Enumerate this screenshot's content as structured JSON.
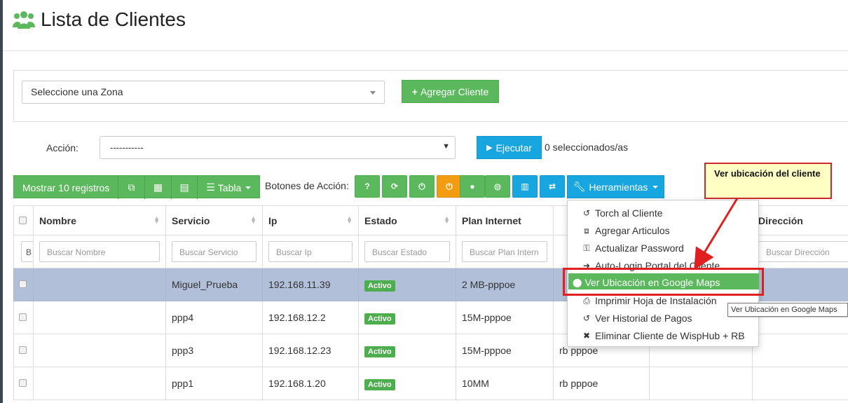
{
  "page": {
    "title": "Lista de Clientes"
  },
  "zone": {
    "placeholder": "Seleccione una Zona",
    "add_client": "Agregar Cliente"
  },
  "action": {
    "label": "Acción:",
    "value": "-----------",
    "execute": "Ejecutar",
    "selected": "0 seleccionados/as"
  },
  "toolbar": {
    "show": "Mostrar 10 registros",
    "tabla": "Tabla",
    "botones_label": "Botones de Acción:",
    "herramientas": "Herramientas"
  },
  "columns": [
    "Nombre",
    "Servicio",
    "Ip",
    "Estado",
    "Plan Internet",
    "",
    "",
    "Dirección"
  ],
  "filters": {
    "first": "B",
    "nombre": "Buscar Nombre",
    "servicio": "Buscar Servicio",
    "ip": "Buscar Ip",
    "estado": "Buscar Estado",
    "plan": "Buscar Plan Intern",
    "direccion": "Buscar Dirección"
  },
  "rows": [
    {
      "nombre": "",
      "servicio": "Miguel_Prueba",
      "ip": "192.168.11.39",
      "estado": "Activo",
      "plan": "2 MB-pppoe",
      "tipo": ""
    },
    {
      "nombre": "",
      "servicio": "ppp4",
      "ip": "192.168.12.2",
      "estado": "Activo",
      "plan": "15M-pppoe",
      "tipo": ""
    },
    {
      "nombre": "",
      "servicio": "ppp3",
      "ip": "192.168.12.23",
      "estado": "Activo",
      "plan": "15M-pppoe",
      "tipo": "rb pppoe"
    },
    {
      "nombre": "",
      "servicio": "ppp1",
      "ip": "192.168.1.20",
      "estado": "Activo",
      "plan": "10MM",
      "tipo": "rb pppoe"
    }
  ],
  "menu": [
    {
      "label": "Torch al Cliente",
      "icon": "history-icon"
    },
    {
      "label": "Agregar Articulos",
      "icon": "cubes-icon"
    },
    {
      "label": "Actualizar Password",
      "icon": "key-icon"
    },
    {
      "label": "Auto-Login Portal del Cliente",
      "icon": "sign-in-icon"
    },
    {
      "label": "Ver Ubicación en Google Maps",
      "icon": "map-marker-icon"
    },
    {
      "label": "Imprimir Hoja de Instalación",
      "icon": "print-icon"
    },
    {
      "label": "Ver Historial de Pagos",
      "icon": "history-icon"
    },
    {
      "label": "Eliminar Cliente de WispHub + RB",
      "icon": "user-times-icon"
    }
  ],
  "callout": {
    "text": "Ver ubicación del cliente"
  },
  "tooltip": {
    "text": "Ver Ubicación en Google Maps"
  },
  "colors": {
    "green": "#5cb85c",
    "blue": "#18a6e0",
    "orange": "#f39c12",
    "selected_row": "#b1bfd8",
    "red": "#e02020"
  }
}
